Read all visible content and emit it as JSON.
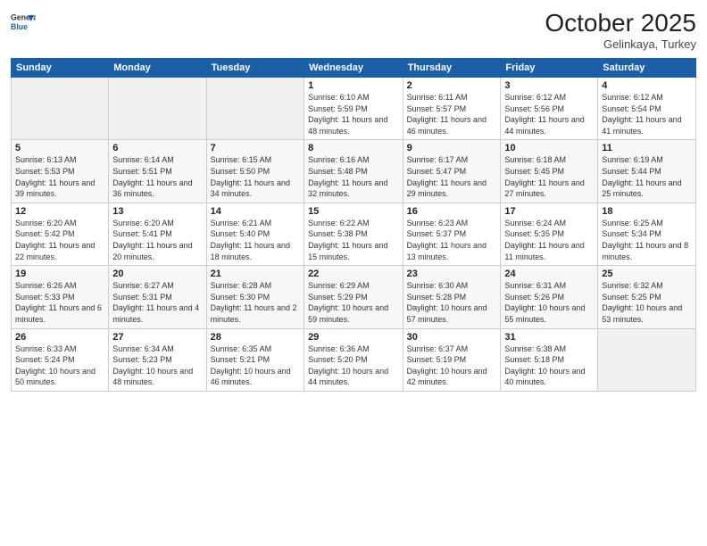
{
  "header": {
    "logo": {
      "general": "General",
      "blue": "Blue"
    },
    "title": "October 2025",
    "location": "Gelinkaya, Turkey"
  },
  "weekdays": [
    "Sunday",
    "Monday",
    "Tuesday",
    "Wednesday",
    "Thursday",
    "Friday",
    "Saturday"
  ],
  "weeks": [
    [
      {
        "day": "",
        "sunrise": "",
        "sunset": "",
        "daylight": ""
      },
      {
        "day": "",
        "sunrise": "",
        "sunset": "",
        "daylight": ""
      },
      {
        "day": "",
        "sunrise": "",
        "sunset": "",
        "daylight": ""
      },
      {
        "day": "1",
        "sunrise": "Sunrise: 6:10 AM",
        "sunset": "Sunset: 5:59 PM",
        "daylight": "Daylight: 11 hours and 48 minutes."
      },
      {
        "day": "2",
        "sunrise": "Sunrise: 6:11 AM",
        "sunset": "Sunset: 5:57 PM",
        "daylight": "Daylight: 11 hours and 46 minutes."
      },
      {
        "day": "3",
        "sunrise": "Sunrise: 6:12 AM",
        "sunset": "Sunset: 5:56 PM",
        "daylight": "Daylight: 11 hours and 44 minutes."
      },
      {
        "day": "4",
        "sunrise": "Sunrise: 6:12 AM",
        "sunset": "Sunset: 5:54 PM",
        "daylight": "Daylight: 11 hours and 41 minutes."
      }
    ],
    [
      {
        "day": "5",
        "sunrise": "Sunrise: 6:13 AM",
        "sunset": "Sunset: 5:53 PM",
        "daylight": "Daylight: 11 hours and 39 minutes."
      },
      {
        "day": "6",
        "sunrise": "Sunrise: 6:14 AM",
        "sunset": "Sunset: 5:51 PM",
        "daylight": "Daylight: 11 hours and 36 minutes."
      },
      {
        "day": "7",
        "sunrise": "Sunrise: 6:15 AM",
        "sunset": "Sunset: 5:50 PM",
        "daylight": "Daylight: 11 hours and 34 minutes."
      },
      {
        "day": "8",
        "sunrise": "Sunrise: 6:16 AM",
        "sunset": "Sunset: 5:48 PM",
        "daylight": "Daylight: 11 hours and 32 minutes."
      },
      {
        "day": "9",
        "sunrise": "Sunrise: 6:17 AM",
        "sunset": "Sunset: 5:47 PM",
        "daylight": "Daylight: 11 hours and 29 minutes."
      },
      {
        "day": "10",
        "sunrise": "Sunrise: 6:18 AM",
        "sunset": "Sunset: 5:45 PM",
        "daylight": "Daylight: 11 hours and 27 minutes."
      },
      {
        "day": "11",
        "sunrise": "Sunrise: 6:19 AM",
        "sunset": "Sunset: 5:44 PM",
        "daylight": "Daylight: 11 hours and 25 minutes."
      }
    ],
    [
      {
        "day": "12",
        "sunrise": "Sunrise: 6:20 AM",
        "sunset": "Sunset: 5:42 PM",
        "daylight": "Daylight: 11 hours and 22 minutes."
      },
      {
        "day": "13",
        "sunrise": "Sunrise: 6:20 AM",
        "sunset": "Sunset: 5:41 PM",
        "daylight": "Daylight: 11 hours and 20 minutes."
      },
      {
        "day": "14",
        "sunrise": "Sunrise: 6:21 AM",
        "sunset": "Sunset: 5:40 PM",
        "daylight": "Daylight: 11 hours and 18 minutes."
      },
      {
        "day": "15",
        "sunrise": "Sunrise: 6:22 AM",
        "sunset": "Sunset: 5:38 PM",
        "daylight": "Daylight: 11 hours and 15 minutes."
      },
      {
        "day": "16",
        "sunrise": "Sunrise: 6:23 AM",
        "sunset": "Sunset: 5:37 PM",
        "daylight": "Daylight: 11 hours and 13 minutes."
      },
      {
        "day": "17",
        "sunrise": "Sunrise: 6:24 AM",
        "sunset": "Sunset: 5:35 PM",
        "daylight": "Daylight: 11 hours and 11 minutes."
      },
      {
        "day": "18",
        "sunrise": "Sunrise: 6:25 AM",
        "sunset": "Sunset: 5:34 PM",
        "daylight": "Daylight: 11 hours and 8 minutes."
      }
    ],
    [
      {
        "day": "19",
        "sunrise": "Sunrise: 6:26 AM",
        "sunset": "Sunset: 5:33 PM",
        "daylight": "Daylight: 11 hours and 6 minutes."
      },
      {
        "day": "20",
        "sunrise": "Sunrise: 6:27 AM",
        "sunset": "Sunset: 5:31 PM",
        "daylight": "Daylight: 11 hours and 4 minutes."
      },
      {
        "day": "21",
        "sunrise": "Sunrise: 6:28 AM",
        "sunset": "Sunset: 5:30 PM",
        "daylight": "Daylight: 11 hours and 2 minutes."
      },
      {
        "day": "22",
        "sunrise": "Sunrise: 6:29 AM",
        "sunset": "Sunset: 5:29 PM",
        "daylight": "Daylight: 10 hours and 59 minutes."
      },
      {
        "day": "23",
        "sunrise": "Sunrise: 6:30 AM",
        "sunset": "Sunset: 5:28 PM",
        "daylight": "Daylight: 10 hours and 57 minutes."
      },
      {
        "day": "24",
        "sunrise": "Sunrise: 6:31 AM",
        "sunset": "Sunset: 5:26 PM",
        "daylight": "Daylight: 10 hours and 55 minutes."
      },
      {
        "day": "25",
        "sunrise": "Sunrise: 6:32 AM",
        "sunset": "Sunset: 5:25 PM",
        "daylight": "Daylight: 10 hours and 53 minutes."
      }
    ],
    [
      {
        "day": "26",
        "sunrise": "Sunrise: 6:33 AM",
        "sunset": "Sunset: 5:24 PM",
        "daylight": "Daylight: 10 hours and 50 minutes."
      },
      {
        "day": "27",
        "sunrise": "Sunrise: 6:34 AM",
        "sunset": "Sunset: 5:23 PM",
        "daylight": "Daylight: 10 hours and 48 minutes."
      },
      {
        "day": "28",
        "sunrise": "Sunrise: 6:35 AM",
        "sunset": "Sunset: 5:21 PM",
        "daylight": "Daylight: 10 hours and 46 minutes."
      },
      {
        "day": "29",
        "sunrise": "Sunrise: 6:36 AM",
        "sunset": "Sunset: 5:20 PM",
        "daylight": "Daylight: 10 hours and 44 minutes."
      },
      {
        "day": "30",
        "sunrise": "Sunrise: 6:37 AM",
        "sunset": "Sunset: 5:19 PM",
        "daylight": "Daylight: 10 hours and 42 minutes."
      },
      {
        "day": "31",
        "sunrise": "Sunrise: 6:38 AM",
        "sunset": "Sunset: 5:18 PM",
        "daylight": "Daylight: 10 hours and 40 minutes."
      },
      {
        "day": "",
        "sunrise": "",
        "sunset": "",
        "daylight": ""
      }
    ]
  ]
}
